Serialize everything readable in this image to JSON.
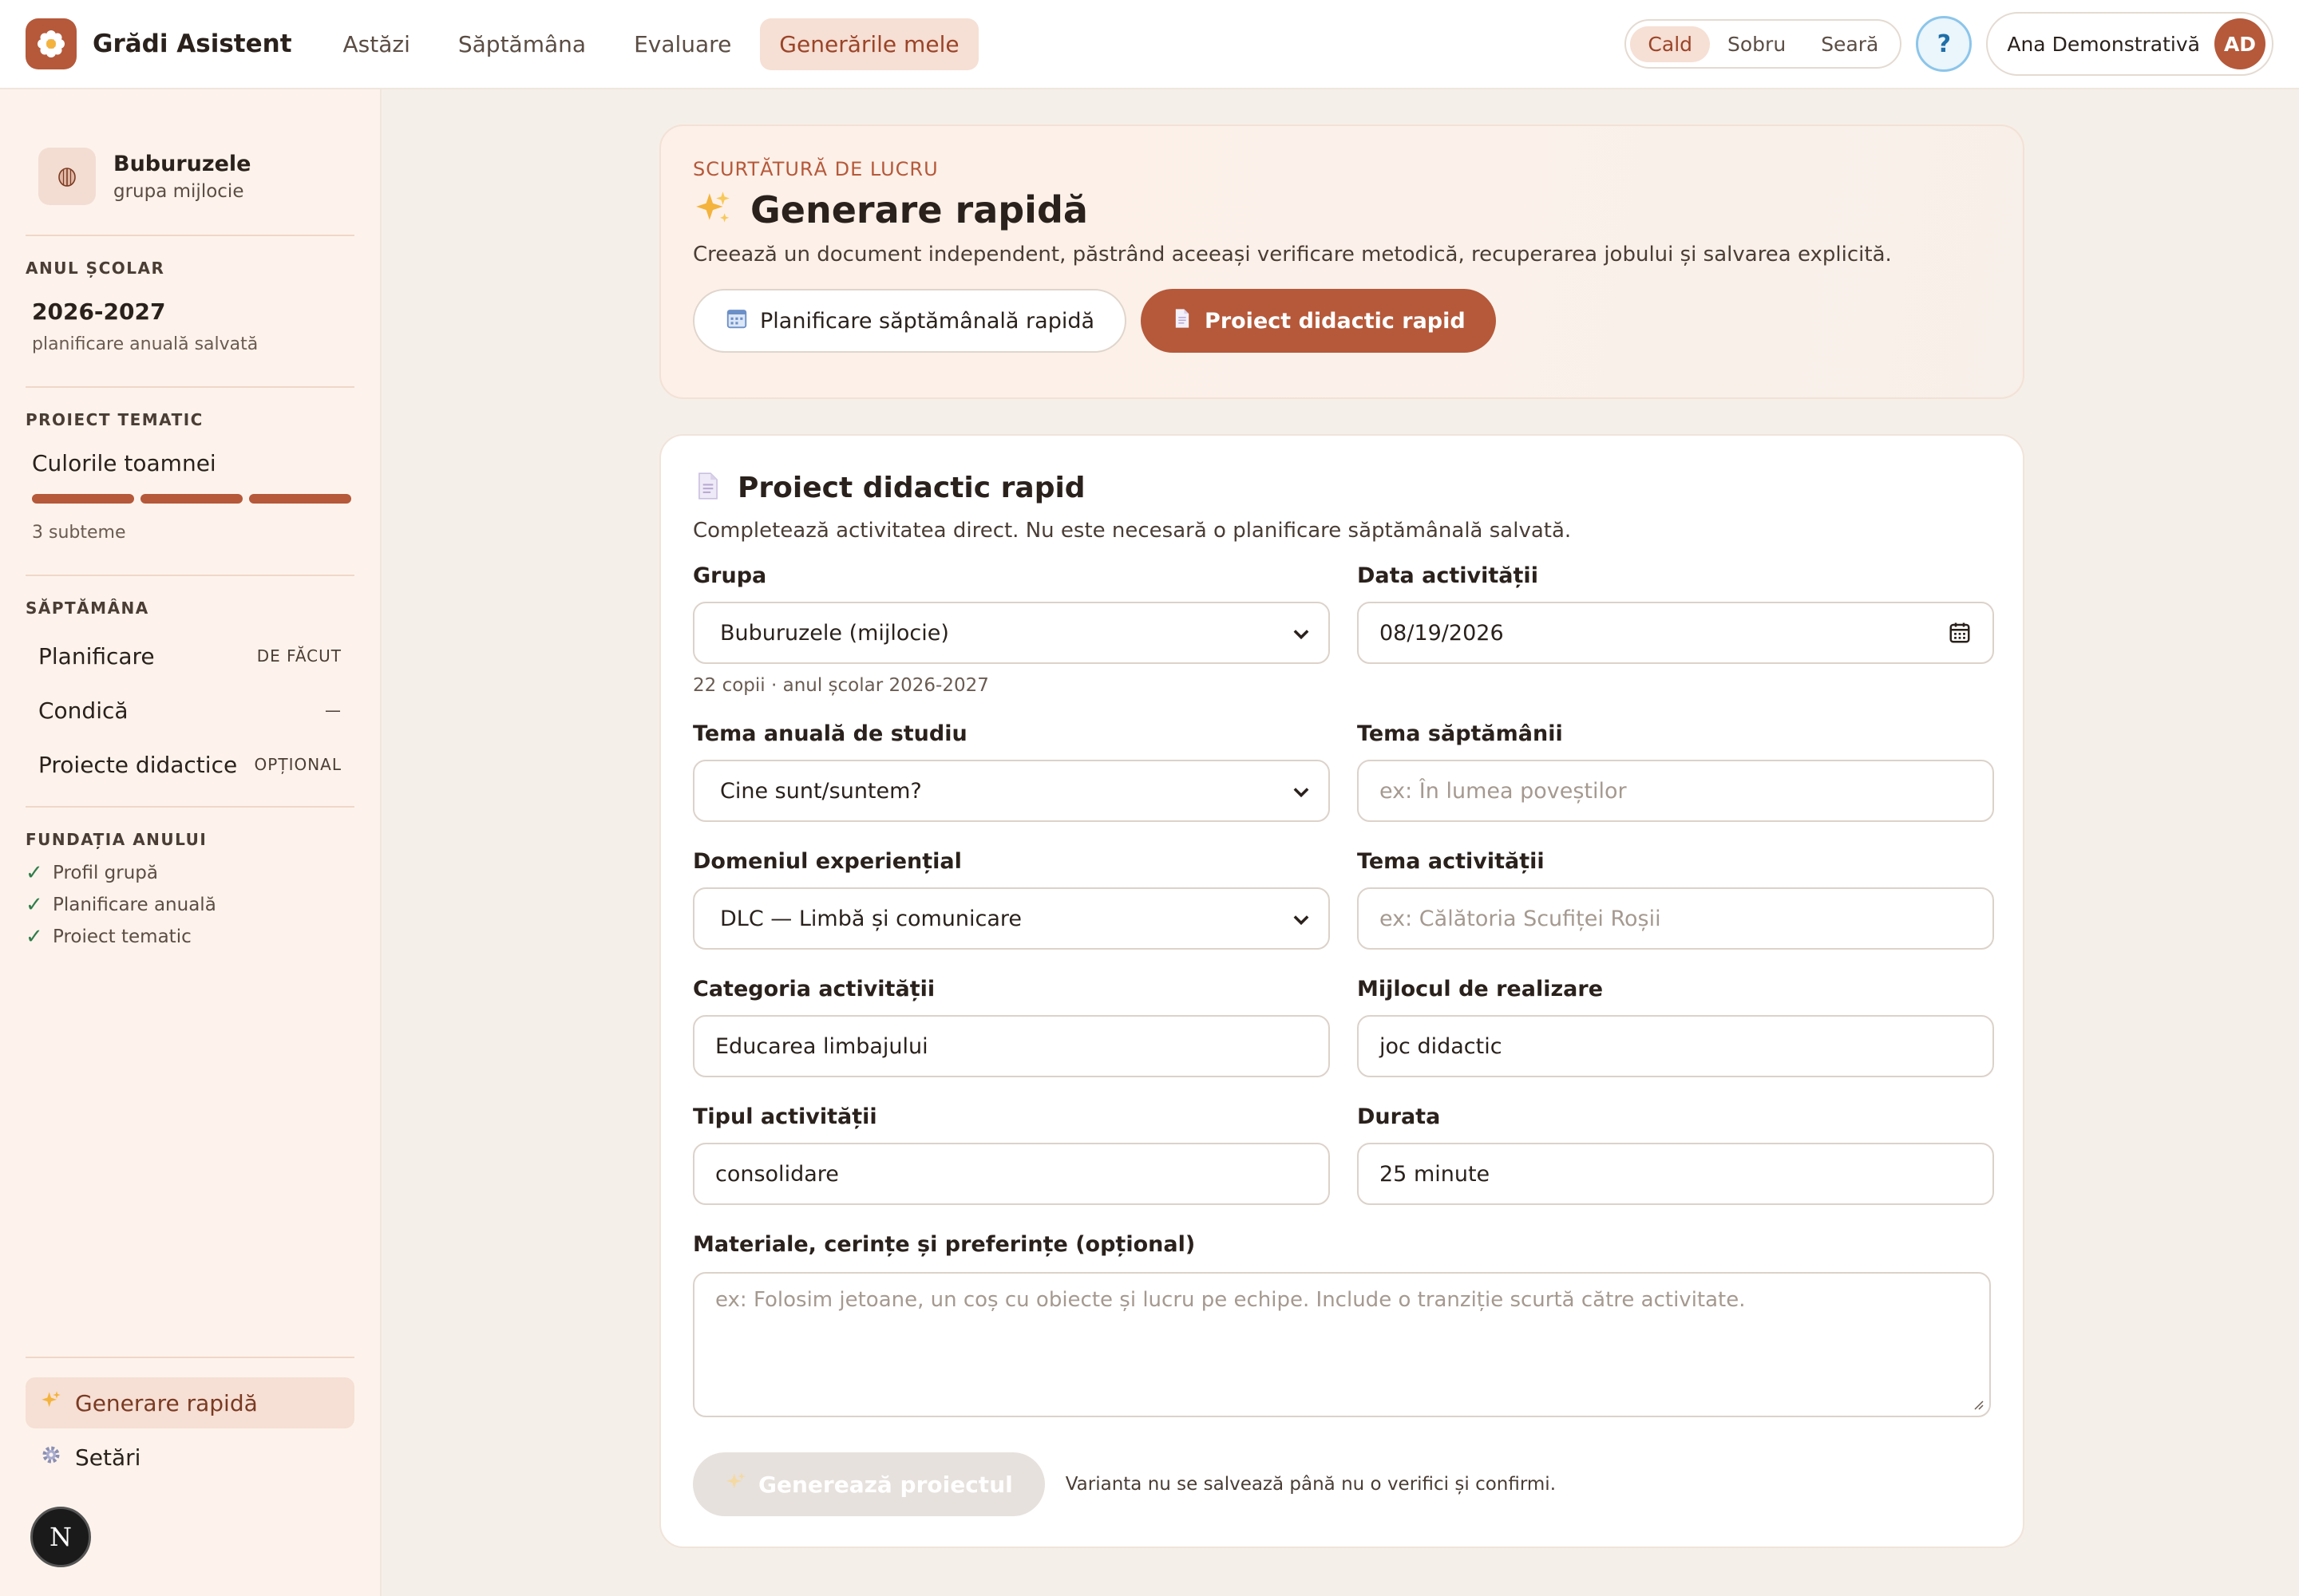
{
  "app": {
    "brand": "Grădi Asistent"
  },
  "nav": {
    "items": [
      {
        "label": "Astăzi"
      },
      {
        "label": "Săptămâna"
      },
      {
        "label": "Evaluare"
      },
      {
        "label": "Generările mele"
      }
    ],
    "active": "Generările mele"
  },
  "theme": {
    "options": [
      "Cald",
      "Sobru",
      "Seară"
    ],
    "selected": "Cald"
  },
  "help": {
    "label": "?"
  },
  "user": {
    "name": "Ana Demonstrativă",
    "initials": "AD"
  },
  "sidebar": {
    "group": {
      "name": "Buburuzele",
      "level": "grupa mijlocie"
    },
    "school_year": {
      "label": "ANUL ȘCOLAR",
      "value": "2026-2027",
      "note": "planificare anuală salvată"
    },
    "thematic_project": {
      "label": "PROIECT TEMATIC",
      "value": "Culorile toamnei",
      "progress_segments": 3,
      "note": "3 subteme"
    },
    "week": {
      "label": "SĂPTĂMÂNA",
      "items": [
        {
          "name": "Planificare",
          "status": "DE FĂCUT"
        },
        {
          "name": "Condică",
          "status": "—"
        },
        {
          "name": "Proiecte didactice",
          "status": "OPȚIONAL"
        }
      ]
    },
    "foundation": {
      "label": "FUNDAȚIA ANULUI",
      "items": [
        "Profil grupă",
        "Planificare anuală",
        "Proiect tematic"
      ]
    },
    "bottom_links": [
      {
        "label": "Generare rapidă",
        "icon": "sparkles-icon"
      },
      {
        "label": "Setări",
        "icon": "gear-icon"
      }
    ],
    "badge": "N"
  },
  "hero": {
    "eyebrow": "SCURTĂTURĂ DE LUCRU",
    "title": "Generare rapidă",
    "description": "Creează un document independent, păstrând aceeași verificare metodică, recuperarea jobului și salvarea explicită.",
    "actions": {
      "weekly": "Planificare săptămânală rapidă",
      "project": "Proiect didactic rapid"
    }
  },
  "form": {
    "title": "Proiect didactic rapid",
    "description": "Completează activitatea direct. Nu este necesară o planificare săptămânală salvată.",
    "group": {
      "label": "Grupa",
      "value": "Buburuzele (mijlocie)",
      "hint": "22 copii · anul școlar 2026-2027"
    },
    "date": {
      "label": "Data activității",
      "value": "08/19/2026"
    },
    "annual_theme": {
      "label": "Tema anuală de studiu",
      "value": "Cine sunt/suntem?"
    },
    "week_theme": {
      "label": "Tema săptămânii",
      "placeholder": "ex: În lumea poveștilor"
    },
    "domain": {
      "label": "Domeniul experiențial",
      "value": "DLC — Limbă și comunicare"
    },
    "activity_theme": {
      "label": "Tema activității",
      "placeholder": "ex: Călătoria Scufiței Roșii"
    },
    "category": {
      "label": "Categoria activității",
      "value": "Educarea limbajului"
    },
    "means": {
      "label": "Mijlocul de realizare",
      "value": "joc didactic"
    },
    "type": {
      "label": "Tipul activității",
      "value": "consolidare"
    },
    "duration": {
      "label": "Durata",
      "value": "25 minute"
    },
    "materials": {
      "label": "Materiale, cerințe și preferințe (opțional)",
      "placeholder": "ex: Folosim jetoane, un coș cu obiecte și lucru pe echipe. Include o tranziție scurtă către activitate."
    },
    "generate": {
      "label": "Generează proiectul",
      "note": "Varianta nu se salvează până nu o verifici și confirmi."
    }
  },
  "colors": {
    "accent": "#b5593a",
    "accent_soft": "#f6dfd4",
    "sidebar_bg": "#fdf3ec",
    "page_bg": "#f5efe9",
    "check": "#2f7d4a"
  }
}
